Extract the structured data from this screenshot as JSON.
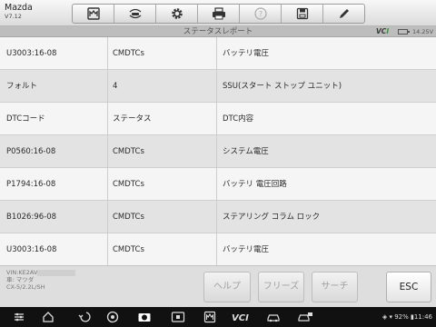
{
  "brand": {
    "name": "Mazda",
    "version": "V7.12"
  },
  "toolbar": [
    {
      "name": "home-icon"
    },
    {
      "name": "vehicle-swap-icon"
    },
    {
      "name": "settings-gear-icon"
    },
    {
      "name": "print-icon"
    },
    {
      "name": "help-icon"
    },
    {
      "name": "save-icon"
    },
    {
      "name": "edit-pen-icon"
    }
  ],
  "title_bar": {
    "title": "ステータスレポート",
    "vci_prefix": "VC",
    "vci_suffix": "I",
    "voltage": "14.25V"
  },
  "table": {
    "rows": [
      {
        "col1": "U3003:16-08",
        "col2": "CMDTCs",
        "col3": "バッテリ電圧"
      },
      {
        "col1": "フォルト",
        "col2": "4",
        "col3": "SSU(スタート ストップ ユニット)"
      },
      {
        "col1": "DTCコード",
        "col2": "ステータス",
        "col3": "DTC内容"
      },
      {
        "col1": "P0560:16-08",
        "col2": "CMDTCs",
        "col3": "システム電圧"
      },
      {
        "col1": "P1794:16-08",
        "col2": "CMDTCs",
        "col3": "バッテリ 電圧回路"
      },
      {
        "col1": "B1026:96-08",
        "col2": "CMDTCs",
        "col3": "ステアリング コラム ロック"
      },
      {
        "col1": "U3003:16-08",
        "col2": "CMDTCs",
        "col3": "バッテリ電圧"
      }
    ]
  },
  "vehicle_info": {
    "vin_label": "VIN:KE2AV",
    "maker": "車: マツダ",
    "model": "CX-5/2.2L/SH"
  },
  "buttons": {
    "help": "ヘルプ",
    "freeze": "フリーズ",
    "search": "サーチ",
    "esc": "ESC"
  },
  "nav_bar": {
    "icons": [
      "settings-icon",
      "home-icon",
      "back-icon",
      "browser-icon",
      "camera-icon",
      "screen-record-icon",
      "maxisys-icon",
      "vci-icon",
      "car-icon",
      "car-scan-icon"
    ],
    "status": "◈ ▾ 92% ▮11:46"
  }
}
